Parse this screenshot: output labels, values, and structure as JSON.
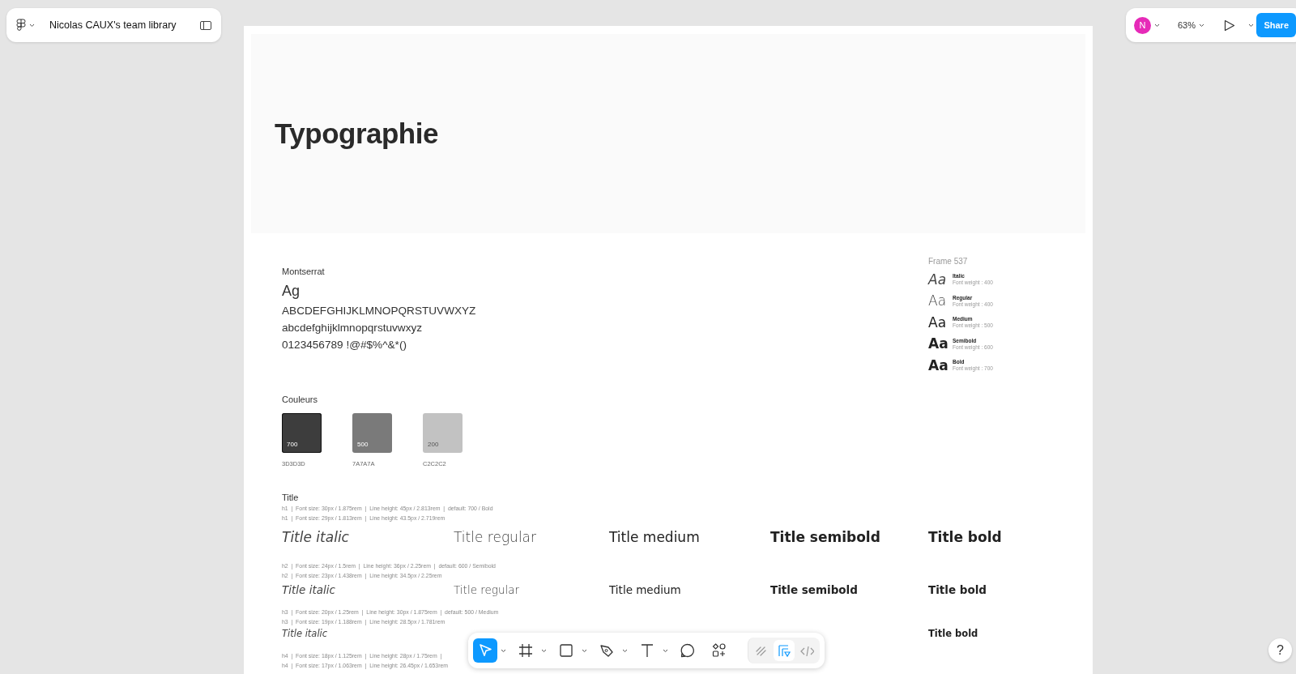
{
  "file_bar": {
    "title": "Nicolas CAUX's team library"
  },
  "top_right": {
    "avatar_initial": "N",
    "zoom": "63%",
    "share": "Share"
  },
  "page": {
    "header_title": "Typographie",
    "font": {
      "name": "Montserrat",
      "sample": "Ag",
      "lines": [
        "ABCDEFGHIJKLMNOPQRSTUVWXYZ",
        "abcdefghijklmnopqrstuvwxyz",
        "0123456789 !@#$%^&*()"
      ]
    },
    "weights_frame": {
      "title": "Frame 537",
      "items": [
        {
          "kind": "italic",
          "sample": "Aa",
          "label": "Italic",
          "detail": "Font weight : 400"
        },
        {
          "kind": "regular",
          "sample": "Aa",
          "label": "Regular",
          "detail": "Font weight : 400"
        },
        {
          "kind": "medium",
          "sample": "Aa",
          "label": "Medium",
          "detail": "Font weight : 500"
        },
        {
          "kind": "semibold",
          "sample": "Aa",
          "label": "Semibold",
          "detail": "Font weight : 600"
        },
        {
          "kind": "bold",
          "sample": "Aa",
          "label": "Bold",
          "detail": "Font weight : 700"
        }
      ]
    },
    "colors": {
      "title": "Couleurs",
      "swatches": [
        {
          "shade": "700",
          "hex_label": "3D3D3D",
          "color": "#3d3d3d"
        },
        {
          "shade": "500",
          "hex_label": "7A7A7A",
          "color": "#7a7a7a"
        },
        {
          "shade": "200",
          "hex_label": "C2C2C2",
          "color": "#c2c2c2"
        }
      ]
    },
    "title_section": {
      "title": "Title",
      "levels": [
        {
          "kind": "h1",
          "specs": [
            "h1  |  Font size: 30px / 1.875rem  |  Line height: 45px / 2.813rem  |  default: 700 / Bold",
            "h1  |  Font size: 29px / 1.813rem  |  Line height: 43.5px / 2.719rem"
          ],
          "samples": [
            {
              "kind": "italic",
              "text": "Title italic"
            },
            {
              "kind": "regular",
              "text": "Title regular"
            },
            {
              "kind": "medium",
              "text": "Title medium"
            },
            {
              "kind": "semibold",
              "text": "Title semibold"
            },
            {
              "kind": "bold",
              "text": "Title bold"
            }
          ]
        },
        {
          "kind": "h2",
          "specs": [
            "h2  |  Font size: 24px / 1.5rem  |  Line height: 36px / 2.25rem  |  default: 600 / Semibold",
            "h2  |  Font size: 23px / 1.438rem  |  Line height: 34.5px / 2.25rem"
          ],
          "samples": [
            {
              "kind": "italic",
              "text": "Title italic"
            },
            {
              "kind": "regular",
              "text": "Title regular"
            },
            {
              "kind": "medium",
              "text": "Title medium"
            },
            {
              "kind": "semibold",
              "text": "Title semibold"
            },
            {
              "kind": "bold",
              "text": "Title bold"
            }
          ]
        },
        {
          "kind": "h3",
          "specs": [
            "h3  |  Font size: 20px / 1.25rem  |  Line height: 30px / 1.875rem  |  default: 500 / Medium",
            "h3  |  Font size: 19px / 1.188rem  |  Line height: 28.5px / 1.781rem"
          ],
          "samples": [
            {
              "kind": "italic",
              "text": "Title italic"
            },
            {
              "kind": "bold",
              "text": "Title bold"
            }
          ]
        },
        {
          "kind": "h4",
          "specs": [
            "h4  |  Font size: 18px / 1.125rem  |  Line height: 28px / 1.75rem  |",
            "h4  |  Font size: 17px / 1.063rem  |  Line height: 26.45px / 1.653rem"
          ]
        }
      ]
    }
  },
  "toolbar": {
    "tools": [
      {
        "kind": "move",
        "selected": true,
        "has_menu": true
      },
      {
        "kind": "frame",
        "selected": false,
        "has_menu": true
      },
      {
        "kind": "rectangle",
        "selected": false,
        "has_menu": true
      },
      {
        "kind": "pen",
        "selected": false,
        "has_menu": true
      },
      {
        "kind": "text",
        "selected": false,
        "has_menu": true
      },
      {
        "kind": "comment",
        "selected": false,
        "has_menu": false
      },
      {
        "kind": "actions",
        "selected": false,
        "has_menu": false
      }
    ],
    "modes": [
      {
        "kind": "draw",
        "selected": false
      },
      {
        "kind": "dev",
        "selected": true
      },
      {
        "kind": "code",
        "selected": false
      }
    ]
  },
  "help": {
    "label": "?"
  }
}
